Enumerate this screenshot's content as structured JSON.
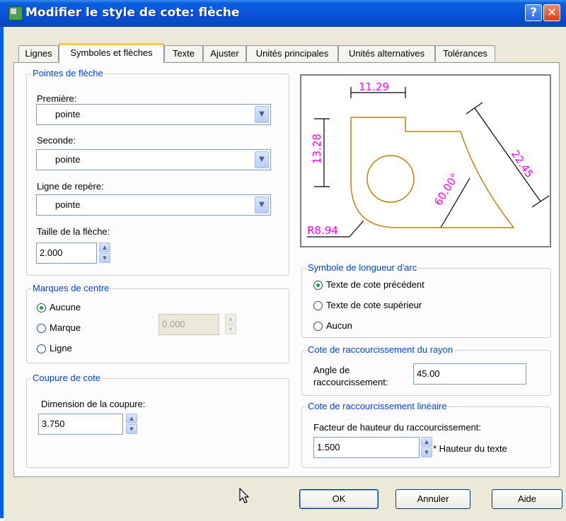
{
  "window": {
    "title": "Modifier le style de cote: flèche",
    "help_label": "?",
    "close_label": "✕"
  },
  "tabs": [
    {
      "label": "Lignes",
      "active": false
    },
    {
      "label": "Symboles et flèches",
      "active": true
    },
    {
      "label": "Texte",
      "active": false
    },
    {
      "label": "Ajuster",
      "active": false
    },
    {
      "label": "Unités principales",
      "active": false
    },
    {
      "label": "Unités alternatives",
      "active": false
    },
    {
      "label": "Tolérances",
      "active": false
    }
  ],
  "arrowheads": {
    "legend": "Pointes de flèche",
    "first_label": "Première:",
    "first_value": "pointe",
    "second_label": "Seconde:",
    "second_value": "pointe",
    "leader_label": "Ligne de repère:",
    "leader_value": "pointe",
    "size_label": "Taille de la flèche:",
    "size_value": "2.000"
  },
  "center_marks": {
    "legend": "Marques de centre",
    "options": [
      "Aucune",
      "Marque",
      "Ligne"
    ],
    "selected": "Aucune",
    "size_value": "0.000"
  },
  "dim_break": {
    "legend": "Coupure de cote",
    "size_label": "Dimension de la coupure:",
    "size_value": "3.750"
  },
  "preview": {
    "dim_top": "11.29",
    "dim_left": "13.28",
    "dim_diag": "22.45",
    "dim_angle": "60.00°",
    "dim_radius": "R8.94"
  },
  "arc_length": {
    "legend": "Symbole de longueur d'arc",
    "options": [
      "Texte de cote précédent",
      "Texte de cote supérieur",
      "Aucun"
    ],
    "selected": "Texte de cote précédent"
  },
  "radius_jog": {
    "legend": "Cote de raccourcissement du rayon",
    "angle_label_line1": "Angle de",
    "angle_label_line2": "raccourcissement:",
    "angle_value": "45.00"
  },
  "linear_jog": {
    "legend": "Cote de raccourcissement linéaire",
    "factor_label": "Facteur de hauteur du raccourcissement:",
    "factor_value": "1.500",
    "suffix": "* Hauteur du texte"
  },
  "buttons": {
    "ok": "OK",
    "cancel": "Annuler",
    "help": "Aide"
  },
  "icons": {
    "app": "dimension-style-icon",
    "cursor": "mouse-pointer-icon"
  },
  "colors": {
    "titlebar": "#0a5fe0",
    "group_legend": "#0046d5",
    "preview_geometry": "#b8860b",
    "preview_dims": "#ff00ff",
    "preview_lines": "#000000"
  }
}
